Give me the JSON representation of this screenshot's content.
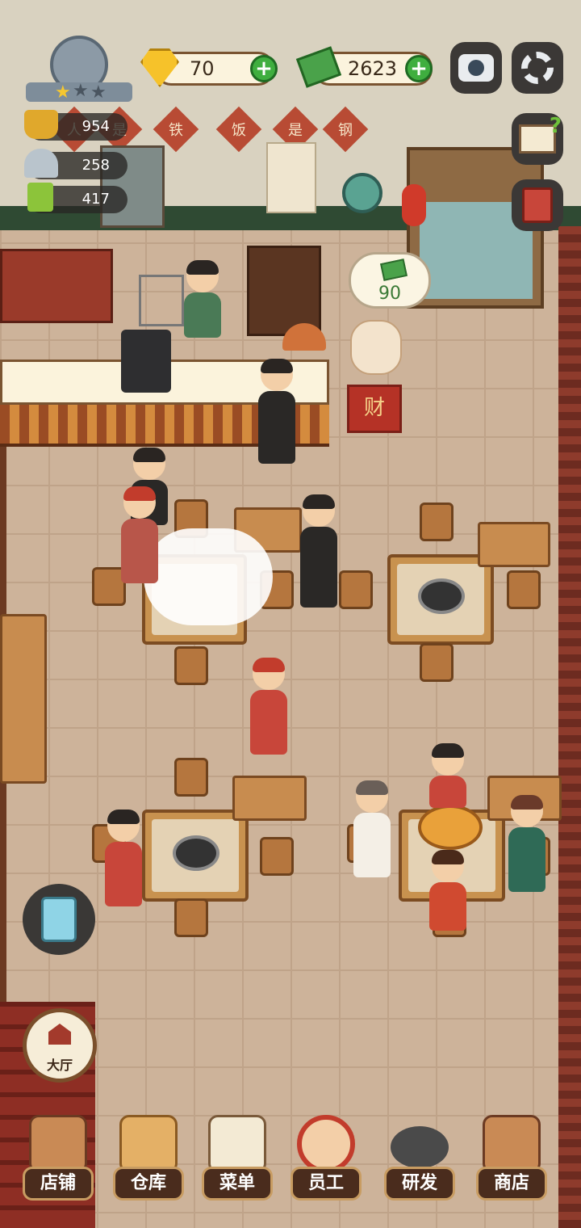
{
  "hud": {
    "gems": "70",
    "cash": "2623",
    "guests": "954",
    "dishes": "258",
    "recipes": "417",
    "wall_sign": [
      "人",
      "是",
      "铁",
      "饭",
      "是",
      "钢"
    ],
    "lucky_cat_char": "财",
    "earnings_bubble": "90"
  },
  "buttons": {
    "hall": "大厅"
  },
  "nav": [
    {
      "label": "店铺",
      "icon": "shop-building-icon"
    },
    {
      "label": "仓库",
      "icon": "boxes-icon"
    },
    {
      "label": "菜单",
      "icon": "menu-clipboard-icon"
    },
    {
      "label": "员工",
      "icon": "staff-icon"
    },
    {
      "label": "研发",
      "icon": "wok-icon"
    },
    {
      "label": "商店",
      "icon": "store-icon"
    }
  ],
  "colors": {
    "accent_green": "#3fae3f",
    "nav_label_bg": "#4a2c1d",
    "wall_stripe": "#2f4a33"
  }
}
